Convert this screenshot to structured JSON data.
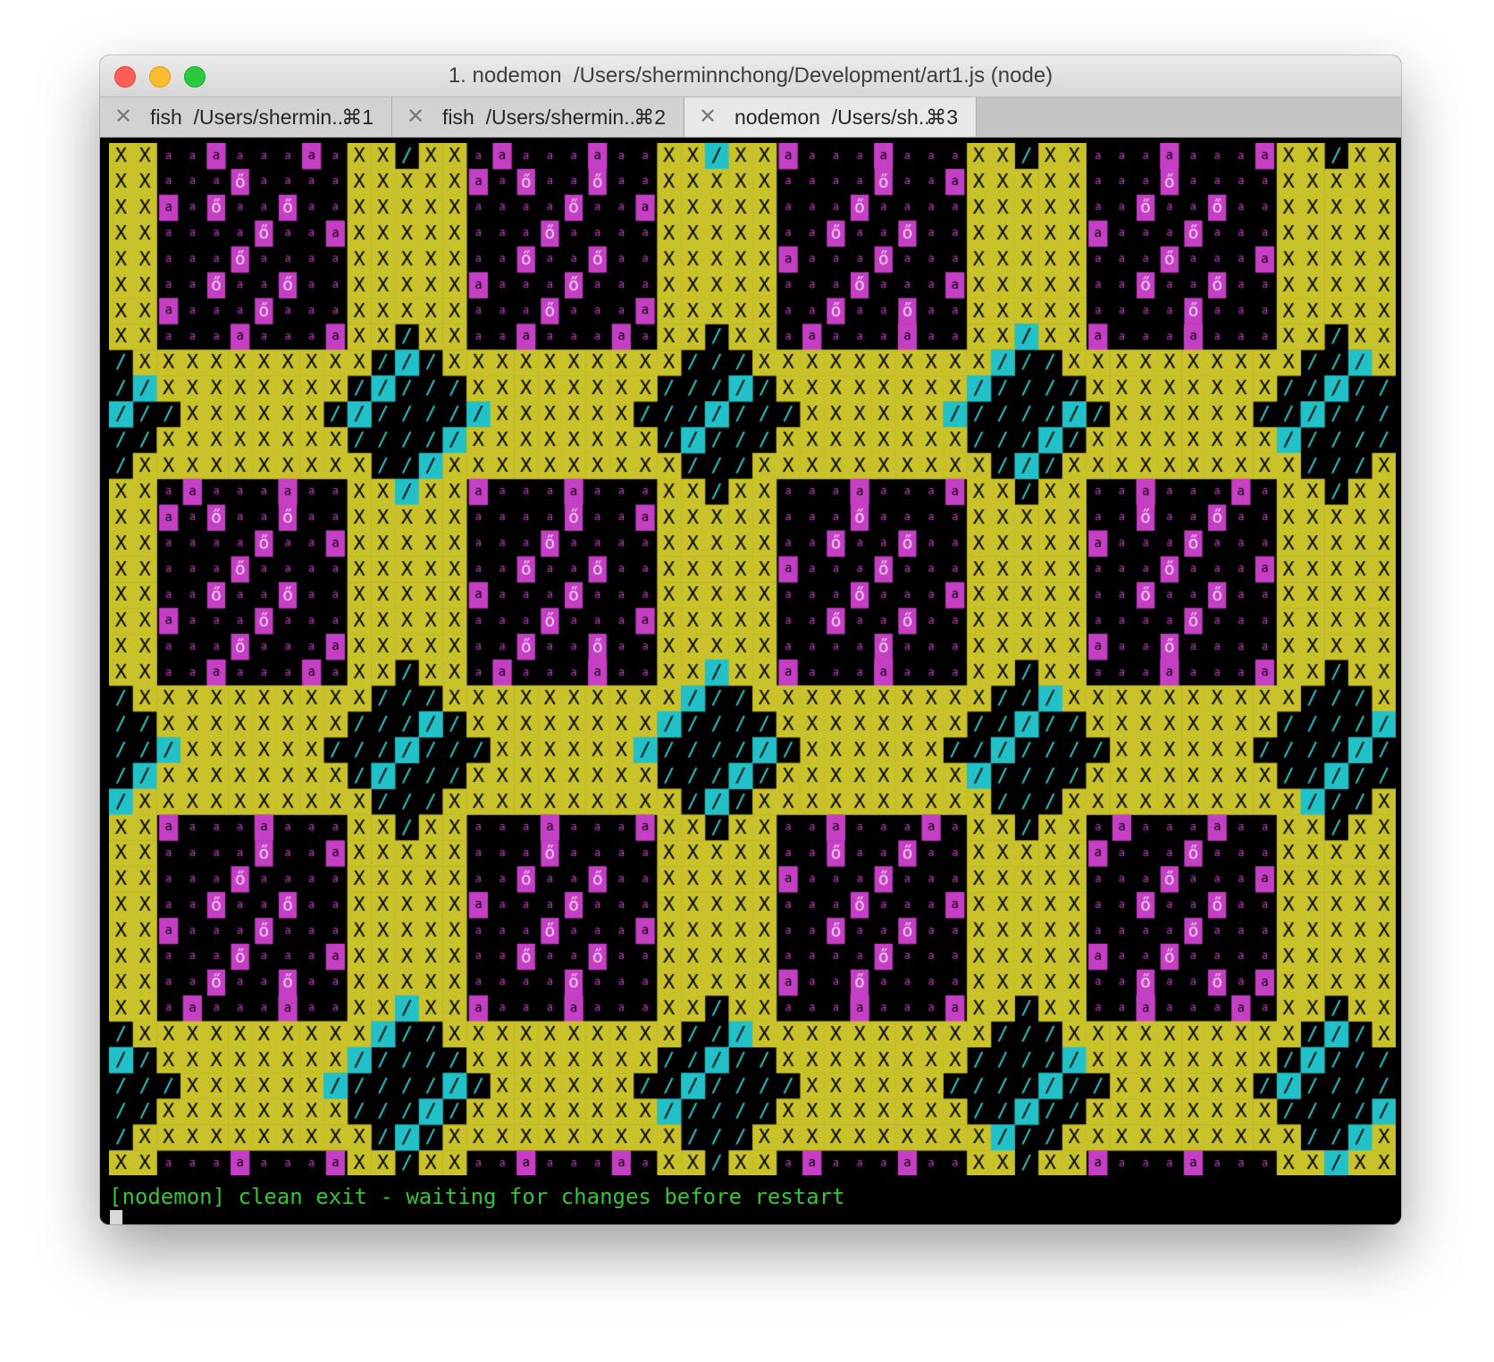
{
  "window": {
    "title": "1. nodemon  /Users/sherminnchong/Development/art1.js (node)",
    "traffic_lights": [
      "close",
      "minimize",
      "zoom"
    ]
  },
  "tabs": [
    {
      "label": "fish  /Users/shermin...",
      "shortcut": "⌘1",
      "active": false
    },
    {
      "label": "fish  /Users/shermin...",
      "shortcut": "⌘2",
      "active": false
    },
    {
      "label": "nodemon  /Users/sh...",
      "shortcut": "⌘3",
      "active": true
    }
  ],
  "tab_close_glyph": "✕",
  "terminal": {
    "status_line": "[nodemon] clean exit - waiting for changes before restart",
    "art_colors": {
      "background": "#000000",
      "yellow_block": "#c9c22b",
      "magenta_block": "#c43fc3",
      "cyan_block": "#22c1c7",
      "small_a": "#c43fc3",
      "dark_text": "#000000",
      "light_slash": "#2ed0d6"
    },
    "art_glyphs": {
      "x": "X",
      "a": "a",
      "o": "ő",
      "slash": "/"
    }
  }
}
